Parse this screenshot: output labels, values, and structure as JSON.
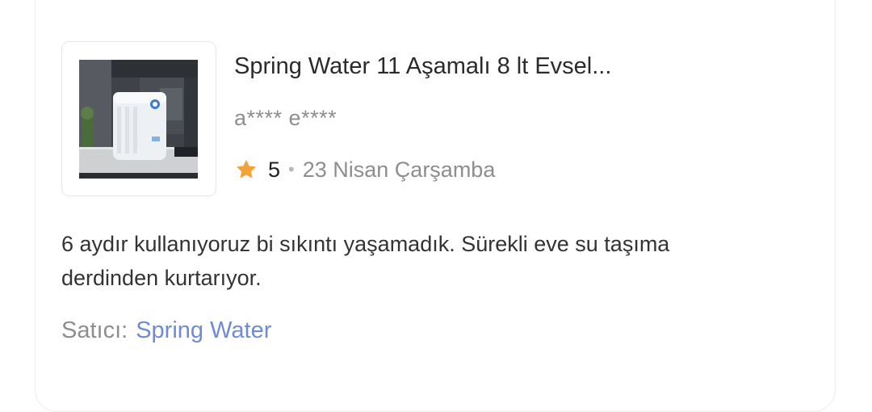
{
  "product": {
    "title": "Spring Water 11 Aşamalı 8 lt Evsel...",
    "image_icon": "water-purifier-image"
  },
  "review": {
    "reviewer": "a**** e****",
    "rating": "5",
    "separator": "•",
    "date": "23 Nisan Çarşamba",
    "text": "6 aydır kullanıyoruz bi sıkıntı yaşamadık. Sürekli eve su taşıma derdinden kurtarıyor."
  },
  "seller": {
    "label": "Satıcı:",
    "name": "Spring Water"
  },
  "colors": {
    "star": "#f2a33a",
    "link": "#6f8bd6",
    "muted_text": "#8e8e8e"
  }
}
